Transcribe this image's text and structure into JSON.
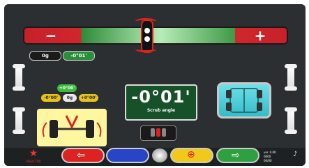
{
  "gauge": {
    "minus_label": "−",
    "plus_label": "+"
  },
  "readouts": {
    "left_small": "0g",
    "right_small": "-0°01'"
  },
  "measurement": {
    "value": "-0°01'",
    "caption": "Scrub angle"
  },
  "axle_pills": {
    "top": "+0°00'",
    "left": "-0°00'",
    "center": "0g",
    "right": "+0°00'"
  },
  "toolbar": {
    "logo_text": "ARGO TRA",
    "right_info_1": "ver. 0.00",
    "right_info_2": "0000",
    "right_info_3": "00/00"
  },
  "colors": {
    "background": "#2c2f31",
    "red": "#d0272d",
    "green": "#3f9a47",
    "cyan": "#34bcc8",
    "yellow": "#e6c21a"
  },
  "icons": {
    "wrench": "wrench-icon",
    "car_top": "car-top-view-icon",
    "axle": "axle-wheels-icon",
    "back": "arrow-left-icon",
    "forward": "arrow-right-icon",
    "action": "target-icon",
    "logo": "star-logo-icon",
    "sound": "speaker-icon"
  }
}
